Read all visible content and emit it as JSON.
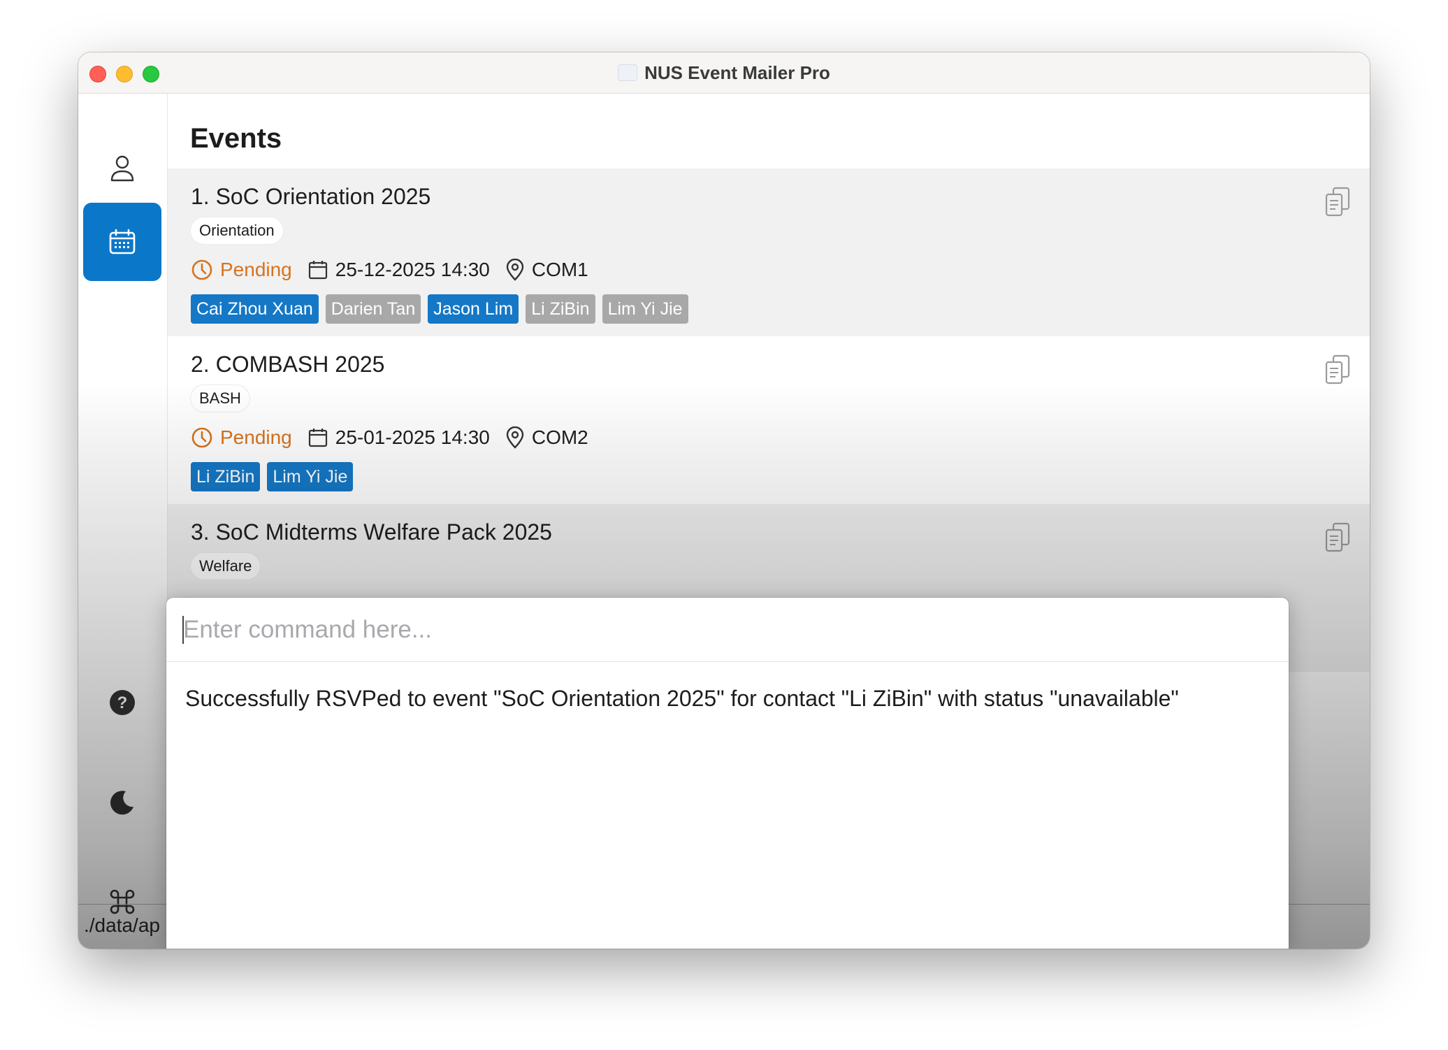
{
  "window": {
    "title": "NUS Event Mailer Pro"
  },
  "sidebar": {
    "items": [
      {
        "icon": "person-icon",
        "active": false
      },
      {
        "icon": "calendar-icon",
        "active": true
      },
      {
        "icon": "help-icon",
        "active": false
      },
      {
        "icon": "moon-icon",
        "active": false
      },
      {
        "icon": "command-icon",
        "active": false
      }
    ]
  },
  "main": {
    "title": "Events",
    "events": [
      {
        "name": "1. SoC Orientation 2025",
        "type": "Orientation",
        "status": "Pending",
        "datetime": "25-12-2025 14:30",
        "location": "COM1",
        "contacts": [
          {
            "name": "Cai Zhou Xuan",
            "state": "going"
          },
          {
            "name": "Darien Tan",
            "state": "unavailable"
          },
          {
            "name": "Jason Lim",
            "state": "going"
          },
          {
            "name": "Li ZiBin",
            "state": "unavailable"
          },
          {
            "name": "Lim Yi Jie",
            "state": "unavailable"
          }
        ]
      },
      {
        "name": "2. COMBASH 2025",
        "type": "BASH",
        "status": "Pending",
        "datetime": "25-01-2025 14:30",
        "location": "COM2",
        "contacts": [
          {
            "name": "Li ZiBin",
            "state": "going"
          },
          {
            "name": "Lim Yi Jie",
            "state": "going"
          }
        ]
      },
      {
        "name": "3. SoC Midterms Welfare Pack 2025",
        "type": "Welfare",
        "contacts": []
      }
    ]
  },
  "status_bar": {
    "path": "./data/ap"
  },
  "command": {
    "placeholder": "Enter command here...",
    "result": "Successfully RSVPed to event \"SoC Orientation 2025\" for contact \"Li ZiBin\" with status \"unavailable\""
  },
  "colors": {
    "accent": "#0b77c9",
    "pending": "#d7731c",
    "chip_going": "#1578c6",
    "chip_unavailable": "#a8a8a8"
  }
}
